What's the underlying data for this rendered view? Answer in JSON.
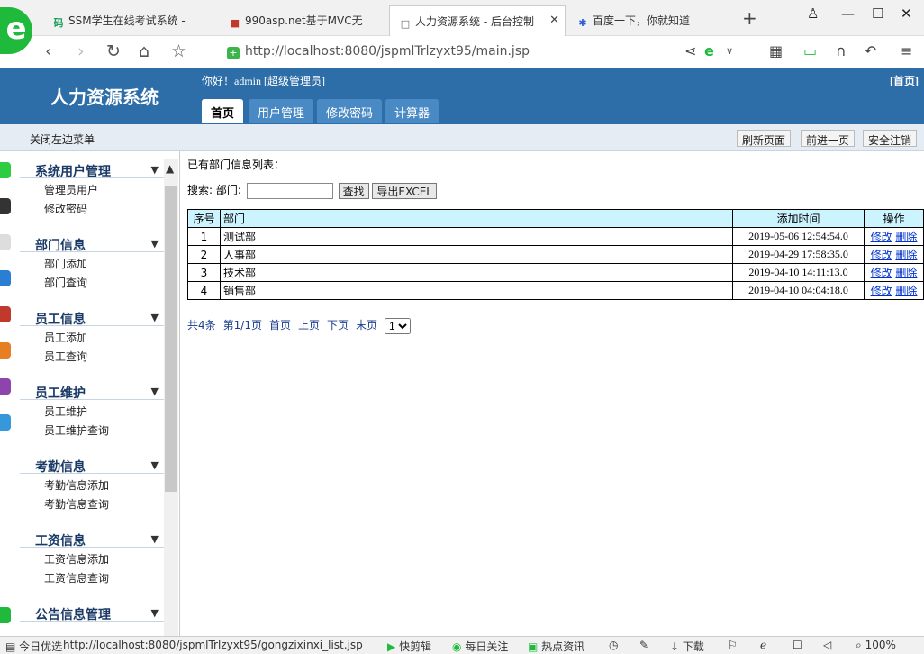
{
  "browser": {
    "tabs": [
      {
        "label": "SSM学生在线考试系统 -",
        "favicon": "码"
      },
      {
        "label": "990asp.net基于MVC无",
        "favicon": "■"
      },
      {
        "label": "人力资源系统 - 后台控制",
        "favicon": "□"
      },
      {
        "label": "百度一下，你就知道",
        "favicon": "✱"
      }
    ],
    "url": "http://localhost:8080/jspmlTrlzyxt95/main.jsp",
    "accent_color": "#1fba3c"
  },
  "header": {
    "app_title": "人力资源系统",
    "greeting": "你好！admin [超级管理员]",
    "home_link": "[首页]",
    "nav": [
      "首页",
      "用户管理",
      "修改密码",
      "计算器"
    ],
    "bg_color": "#2e6ea8"
  },
  "subbar": {
    "toggle_label": "关闭左边菜单",
    "refresh": "刷新页面",
    "forward": "前进一页",
    "logout": "安全注销"
  },
  "sidebar": {
    "groups": [
      {
        "title": "系统用户管理",
        "items": [
          "管理员用户",
          "修改密码"
        ]
      },
      {
        "title": "部门信息",
        "items": [
          "部门添加",
          "部门查询"
        ]
      },
      {
        "title": "员工信息",
        "items": [
          "员工添加",
          "员工查询"
        ]
      },
      {
        "title": "员工维护",
        "items": [
          "员工维护",
          "员工维护查询"
        ]
      },
      {
        "title": "考勤信息",
        "items": [
          "考勤信息添加",
          "考勤信息查询"
        ]
      },
      {
        "title": "工资信息",
        "items": [
          "工资信息添加",
          "工资信息查询"
        ]
      },
      {
        "title": "公告信息管理",
        "items": []
      }
    ]
  },
  "main": {
    "list_title": "已有部门信息列表：",
    "search_label": "搜索: 部门:",
    "search_value": "",
    "search_button": "查找",
    "export_button": "导出EXCEL",
    "columns": [
      "序号",
      "部门",
      "添加时间",
      "操作"
    ],
    "rows": [
      {
        "num": "1",
        "dept": "测试部",
        "time": "2019-05-06 12:54:54.0"
      },
      {
        "num": "2",
        "dept": "人事部",
        "time": "2019-04-29 17:58:35.0"
      },
      {
        "num": "3",
        "dept": "技术部",
        "time": "2019-04-10 14:11:13.0"
      },
      {
        "num": "4",
        "dept": "销售部",
        "time": "2019-04-10 04:04:18.0"
      }
    ],
    "edit_label": "修改",
    "delete_label": "删除",
    "header_bg": "#ccf4ff",
    "pager": {
      "total": "共4条",
      "page": "第1/1页",
      "first": "首页",
      "prev": "上页",
      "next": "下页",
      "last": "末页",
      "selected_page": "1"
    }
  },
  "statusbar": {
    "today": "今日优选",
    "status_url": "http://localhost:8080/jspmlTrlzyxt95/gongzixinxi_list.jsp",
    "clip": "快剪辑",
    "daily": "每日关注",
    "news": "热点资讯",
    "download": "下载",
    "zoom": "100%"
  }
}
